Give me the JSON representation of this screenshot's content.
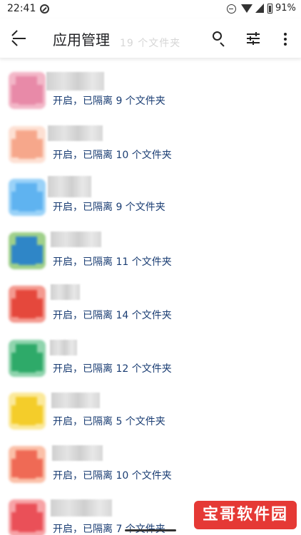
{
  "status_bar": {
    "time": "22:41",
    "battery": "91%"
  },
  "app_bar": {
    "title": "应用管理"
  },
  "ghost_text": "19 个文件夹",
  "colors": {
    "status_text": "#1a3d73",
    "watermark_bg": "#e53935"
  },
  "apps": [
    {
      "status": "开启，已隔离 9 个文件夹",
      "icon_color": "#e88aa8",
      "icon_accent": "#f3b7c8"
    },
    {
      "status": "开启，已隔离 10 个文件夹",
      "icon_color": "#f6a78b",
      "icon_accent": "#fde0d3"
    },
    {
      "status": "开启，已隔离 9 个文件夹",
      "icon_color": "#5fb3f0",
      "icon_accent": "#9ad2f8"
    },
    {
      "status": "开启，已隔离 11 个文件夹",
      "icon_color": "#2f86c7",
      "icon_accent": "#9fd08a"
    },
    {
      "status": "开启，已隔离 14 个文件夹",
      "icon_color": "#e5483c",
      "icon_accent": "#f49a90"
    },
    {
      "status": "开启，已隔离 12 个文件夹",
      "icon_color": "#2eaa69",
      "icon_accent": "#8fd4ad"
    },
    {
      "status": "开启，已隔离 5 个文件夹",
      "icon_color": "#f4cd2a",
      "icon_accent": "#fbe99a"
    },
    {
      "status": "开启，已隔离 10 个文件夹",
      "icon_color": "#ef6a55",
      "icon_accent": "#fbc0a8"
    },
    {
      "status": "开启，已隔离 7 个文件夹",
      "icon_color": "#ea5058",
      "icon_accent": "#f7a3a6"
    }
  ],
  "watermark": "宝哥软件园"
}
